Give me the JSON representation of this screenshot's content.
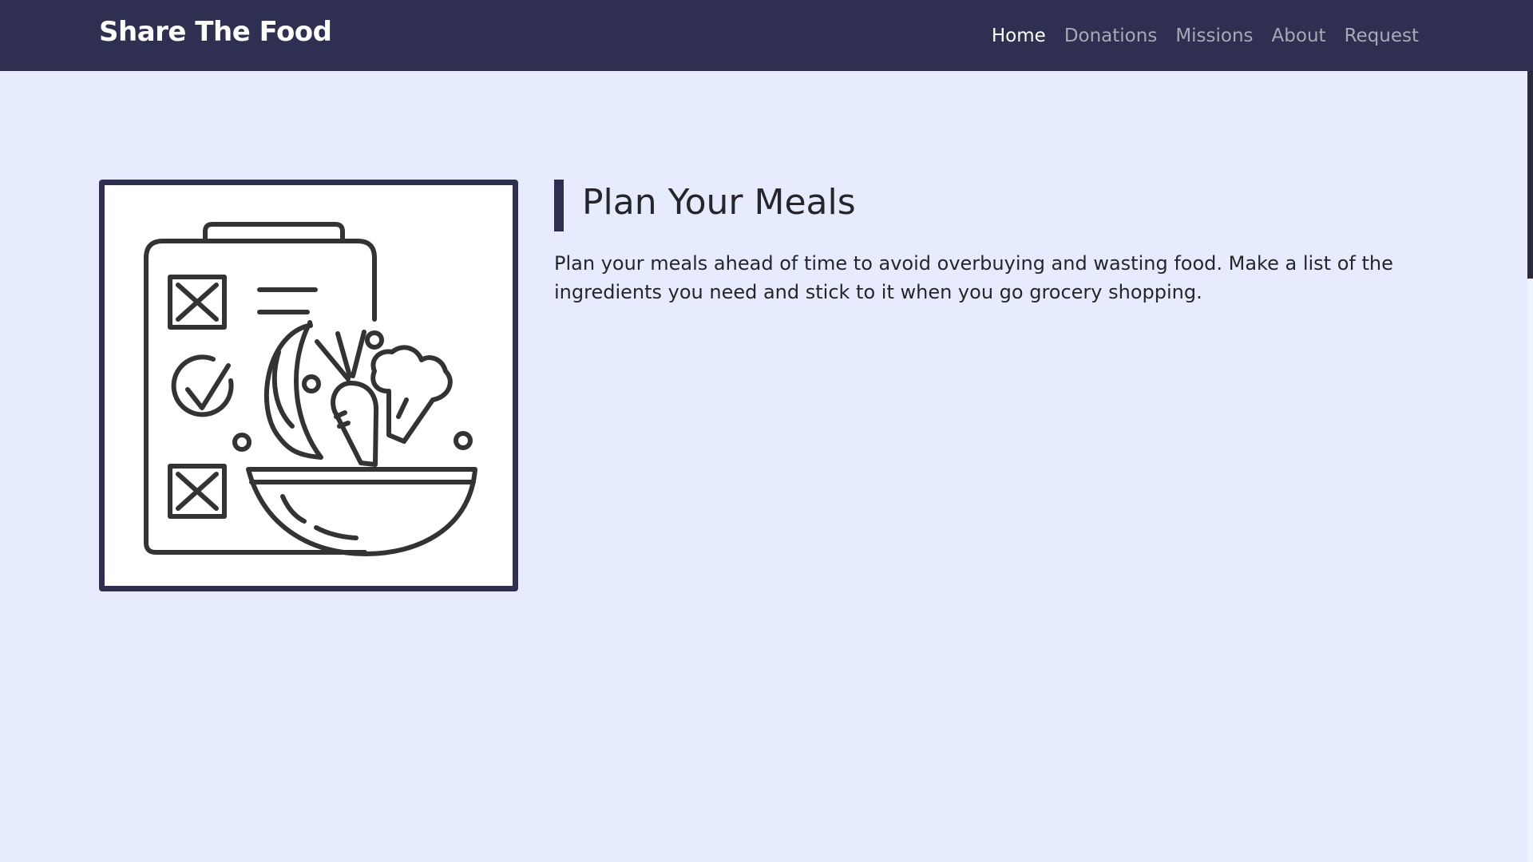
{
  "brand": "Share The Food",
  "nav": {
    "items": [
      "Home",
      "Donations",
      "Missions",
      "About",
      "Request"
    ],
    "active": "Home"
  },
  "section": {
    "title": "Plan Your Meals",
    "body": "Plan your meals ahead of time to avoid overbuying and wasting food. Make a list of the ingredients you need and stick to it when you go grocery shopping.",
    "image_icon": "meal-plan-checklist-icon"
  },
  "colors": {
    "navbar": "#2f2f52",
    "page_background": "#e6ecfd",
    "accent": "#2f2f52",
    "nav_active": "#ffffff",
    "nav_inactive": "#a8a9b4",
    "text": "#25252b"
  }
}
